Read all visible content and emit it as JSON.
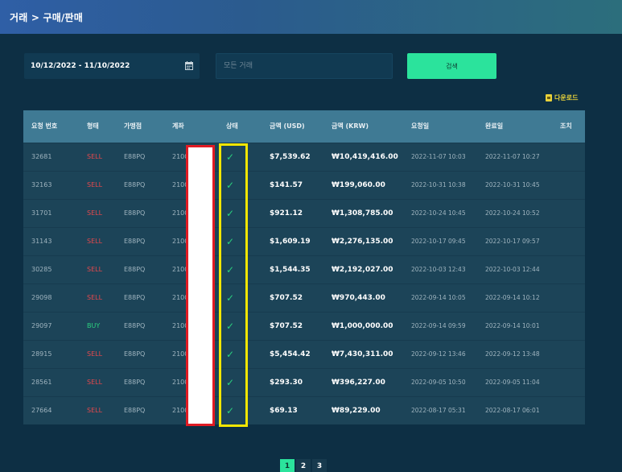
{
  "header": {
    "breadcrumb": "거래 > 구매/판매"
  },
  "filters": {
    "date_range": "10/12/2022 - 11/10/2022",
    "search_placeholder": "모든 거래",
    "search_button": "검색"
  },
  "download_label": "다운로드",
  "table": {
    "columns": [
      "요청 번호",
      "형태",
      "가맹점",
      "계좌",
      "상태",
      "금액 (USD)",
      "금액 (KRW)",
      "요청일",
      "완료일",
      "조치"
    ],
    "rows": [
      {
        "id": "32681",
        "type": "SELL",
        "merchant": "E88PQ",
        "account": "2100",
        "status": "✓",
        "usd": "$7,539.62",
        "krw": "₩10,419,416.00",
        "requested": "2022-11-07 10:03",
        "completed": "2022-11-07 10:27",
        "action": ""
      },
      {
        "id": "32163",
        "type": "SELL",
        "merchant": "E88PQ",
        "account": "2100",
        "status": "✓",
        "usd": "$141.57",
        "krw": "₩199,060.00",
        "requested": "2022-10-31 10:38",
        "completed": "2022-10-31 10:45",
        "action": ""
      },
      {
        "id": "31701",
        "type": "SELL",
        "merchant": "E88PQ",
        "account": "2100",
        "status": "✓",
        "usd": "$921.12",
        "krw": "₩1,308,785.00",
        "requested": "2022-10-24 10:45",
        "completed": "2022-10-24 10:52",
        "action": ""
      },
      {
        "id": "31143",
        "type": "SELL",
        "merchant": "E88PQ",
        "account": "2100",
        "status": "✓",
        "usd": "$1,609.19",
        "krw": "₩2,276,135.00",
        "requested": "2022-10-17 09:45",
        "completed": "2022-10-17 09:57",
        "action": ""
      },
      {
        "id": "30285",
        "type": "SELL",
        "merchant": "E88PQ",
        "account": "2100",
        "status": "✓",
        "usd": "$1,544.35",
        "krw": "₩2,192,027.00",
        "requested": "2022-10-03 12:43",
        "completed": "2022-10-03 12:44",
        "action": ""
      },
      {
        "id": "29098",
        "type": "SELL",
        "merchant": "E88PQ",
        "account": "2100",
        "status": "✓",
        "usd": "$707.52",
        "krw": "₩970,443.00",
        "requested": "2022-09-14 10:05",
        "completed": "2022-09-14 10:12",
        "action": ""
      },
      {
        "id": "29097",
        "type": "BUY",
        "merchant": "E88PQ",
        "account": "2100",
        "status": "✓",
        "usd": "$707.52",
        "krw": "₩1,000,000.00",
        "requested": "2022-09-14 09:59",
        "completed": "2022-09-14 10:01",
        "action": ""
      },
      {
        "id": "28915",
        "type": "SELL",
        "merchant": "E88PQ",
        "account": "2100",
        "status": "✓",
        "usd": "$5,454.42",
        "krw": "₩7,430,311.00",
        "requested": "2022-09-12 13:46",
        "completed": "2022-09-12 13:48",
        "action": ""
      },
      {
        "id": "28561",
        "type": "SELL",
        "merchant": "E88PQ",
        "account": "2100",
        "status": "✓",
        "usd": "$293.30",
        "krw": "₩396,227.00",
        "requested": "2022-09-05 10:50",
        "completed": "2022-09-05 11:04",
        "action": ""
      },
      {
        "id": "27664",
        "type": "SELL",
        "merchant": "E88PQ",
        "account": "2100",
        "status": "✓",
        "usd": "$69.13",
        "krw": "₩89,229.00",
        "requested": "2022-08-17 05:31",
        "completed": "2022-08-17 06:01",
        "action": ""
      }
    ]
  },
  "pagination": {
    "pages": [
      "1",
      "2",
      "3"
    ],
    "current": "1"
  },
  "colors": {
    "background": "#0d2f44",
    "accent": "#2be39c",
    "sell": "#e5484d",
    "buy": "#2bd07f",
    "download": "#e8d23a"
  }
}
